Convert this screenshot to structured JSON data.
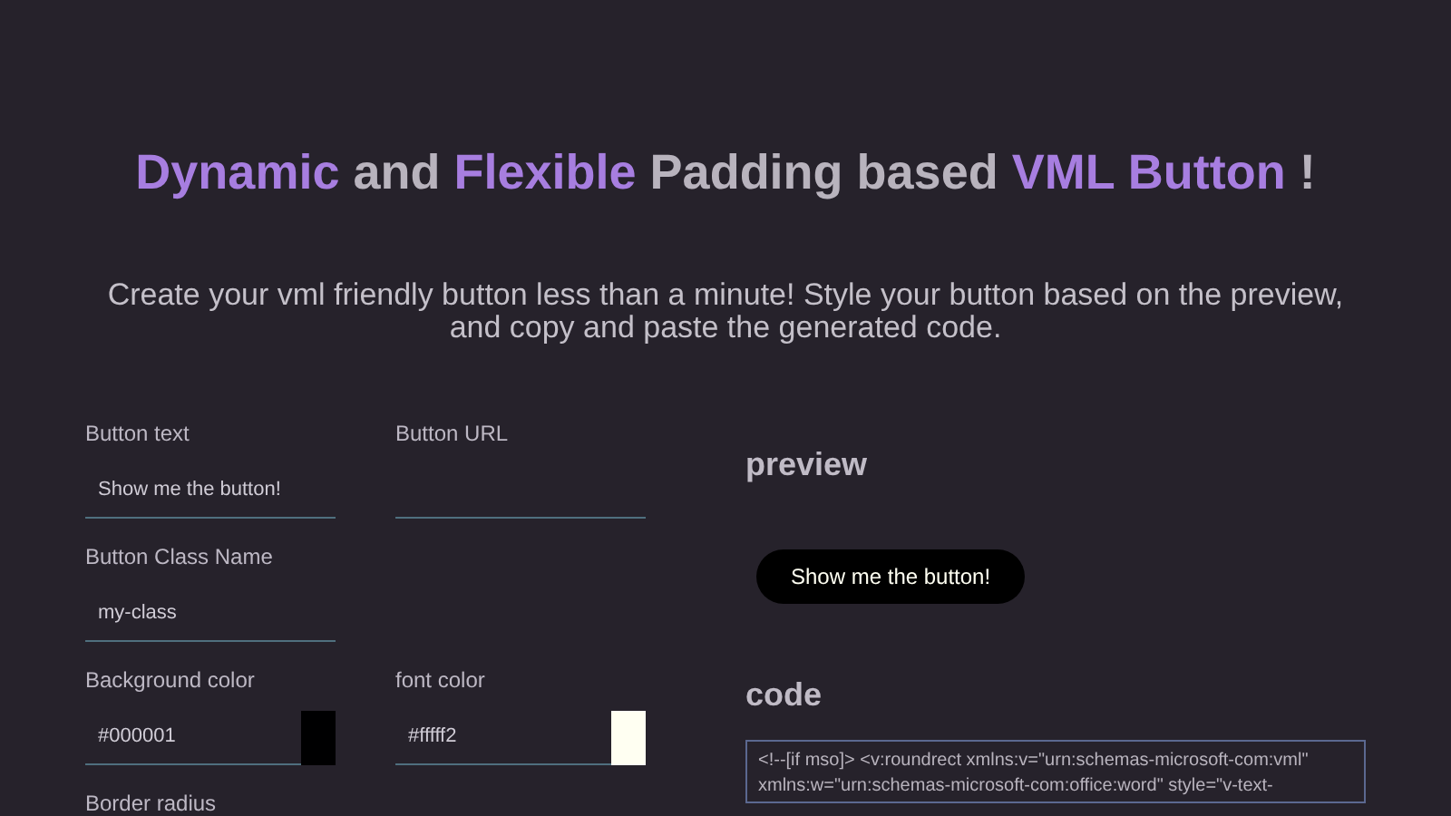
{
  "title": [
    {
      "text": "Dynamic",
      "accent": true
    },
    {
      "text": " and ",
      "accent": false
    },
    {
      "text": "Flexible",
      "accent": true
    },
    {
      "text": " Padding based ",
      "accent": false
    },
    {
      "text": "VML Button",
      "accent": true
    },
    {
      "text": " !",
      "accent": false
    }
  ],
  "subtitle": "Create your vml friendly button less than a minute! Style your button based on the preview, and copy and paste the generated code.",
  "form_rows": [
    [
      {
        "kind": "text",
        "label": "Button text",
        "value": "Show me the button!"
      },
      {
        "kind": "text",
        "label": "Button URL"
      }
    ],
    [
      {
        "kind": "text",
        "label": "Button Class Name",
        "value": "my-class"
      }
    ],
    [
      {
        "kind": "color",
        "label": "Background color",
        "value": "#000001",
        "color": "#000001"
      },
      {
        "kind": "color",
        "label": "font color",
        "value": "#fffff2",
        "color": "#fffff2"
      }
    ],
    [
      {
        "kind": "label",
        "label": "Border radius"
      }
    ]
  ],
  "preview": {
    "heading": "preview",
    "button_text": "Show me the button!"
  },
  "code": {
    "heading": "code",
    "text": "<!--[if mso]> <v:roundrect xmlns:v=\"urn:schemas-microsoft-com:vml\" xmlns:w=\"urn:schemas-microsoft-com:office:word\" style=\"v-text-"
  }
}
